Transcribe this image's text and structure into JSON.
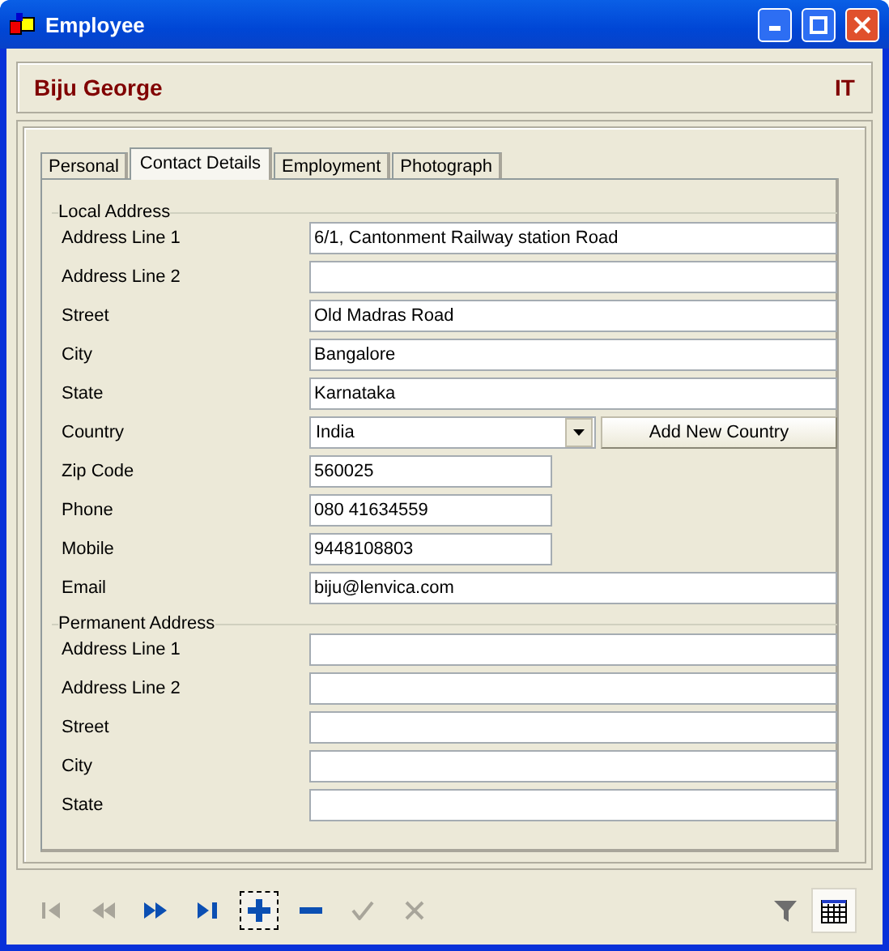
{
  "window": {
    "title": "Employee"
  },
  "header": {
    "name": "Biju George",
    "department": "IT"
  },
  "tabs": [
    {
      "label": "Personal",
      "selected": false
    },
    {
      "label": "Contact Details",
      "selected": true
    },
    {
      "label": "Employment",
      "selected": false
    },
    {
      "label": "Photograph",
      "selected": false
    }
  ],
  "groups": [
    {
      "title": "Local Address",
      "fields": [
        {
          "label": "Address Line 1",
          "kind": "full",
          "value": "6/1, Cantonment Railway station Road"
        },
        {
          "label": "Address Line 2",
          "kind": "full"
        },
        {
          "label": "Street",
          "kind": "full",
          "value": "Old Madras Road"
        },
        {
          "label": "City",
          "kind": "full",
          "value": "Bangalore"
        },
        {
          "label": "State",
          "kind": "full",
          "value": "Karnataka"
        },
        {
          "label": "Country",
          "kind": "dropdown",
          "value": "India",
          "button": "Add New Country"
        },
        {
          "label": "Zip Code",
          "kind": "short",
          "value": "560025"
        },
        {
          "label": "Phone",
          "kind": "short",
          "value": "080 41634559"
        },
        {
          "label": "Mobile",
          "kind": "short",
          "value": "9448108803"
        },
        {
          "label": "Email",
          "kind": "full",
          "value": "biju@lenvica.com"
        }
      ]
    },
    {
      "title": "Permanent Address",
      "fields": [
        {
          "label": "Address Line 1",
          "kind": "full"
        },
        {
          "label": "Address Line 2",
          "kind": "full"
        },
        {
          "label": "Street",
          "kind": "full"
        },
        {
          "label": "City",
          "kind": "full"
        },
        {
          "label": "State",
          "kind": "full"
        }
      ]
    }
  ],
  "toolbar": [
    {
      "kind": "first",
      "disabled": true,
      "selected": false
    },
    {
      "kind": "prev",
      "disabled": true,
      "selected": false
    },
    {
      "kind": "next",
      "disabled": false,
      "selected": false
    },
    {
      "kind": "last",
      "disabled": false,
      "selected": false
    },
    {
      "kind": "add",
      "disabled": false,
      "selected": true
    },
    {
      "kind": "remove",
      "disabled": false,
      "selected": false
    },
    {
      "kind": "save",
      "disabled": true,
      "selected": false
    },
    {
      "kind": "cancel",
      "disabled": true,
      "selected": false
    }
  ],
  "view_tools": [
    {
      "kind": "filter",
      "selected": false
    },
    {
      "kind": "grid",
      "selected": true
    }
  ]
}
